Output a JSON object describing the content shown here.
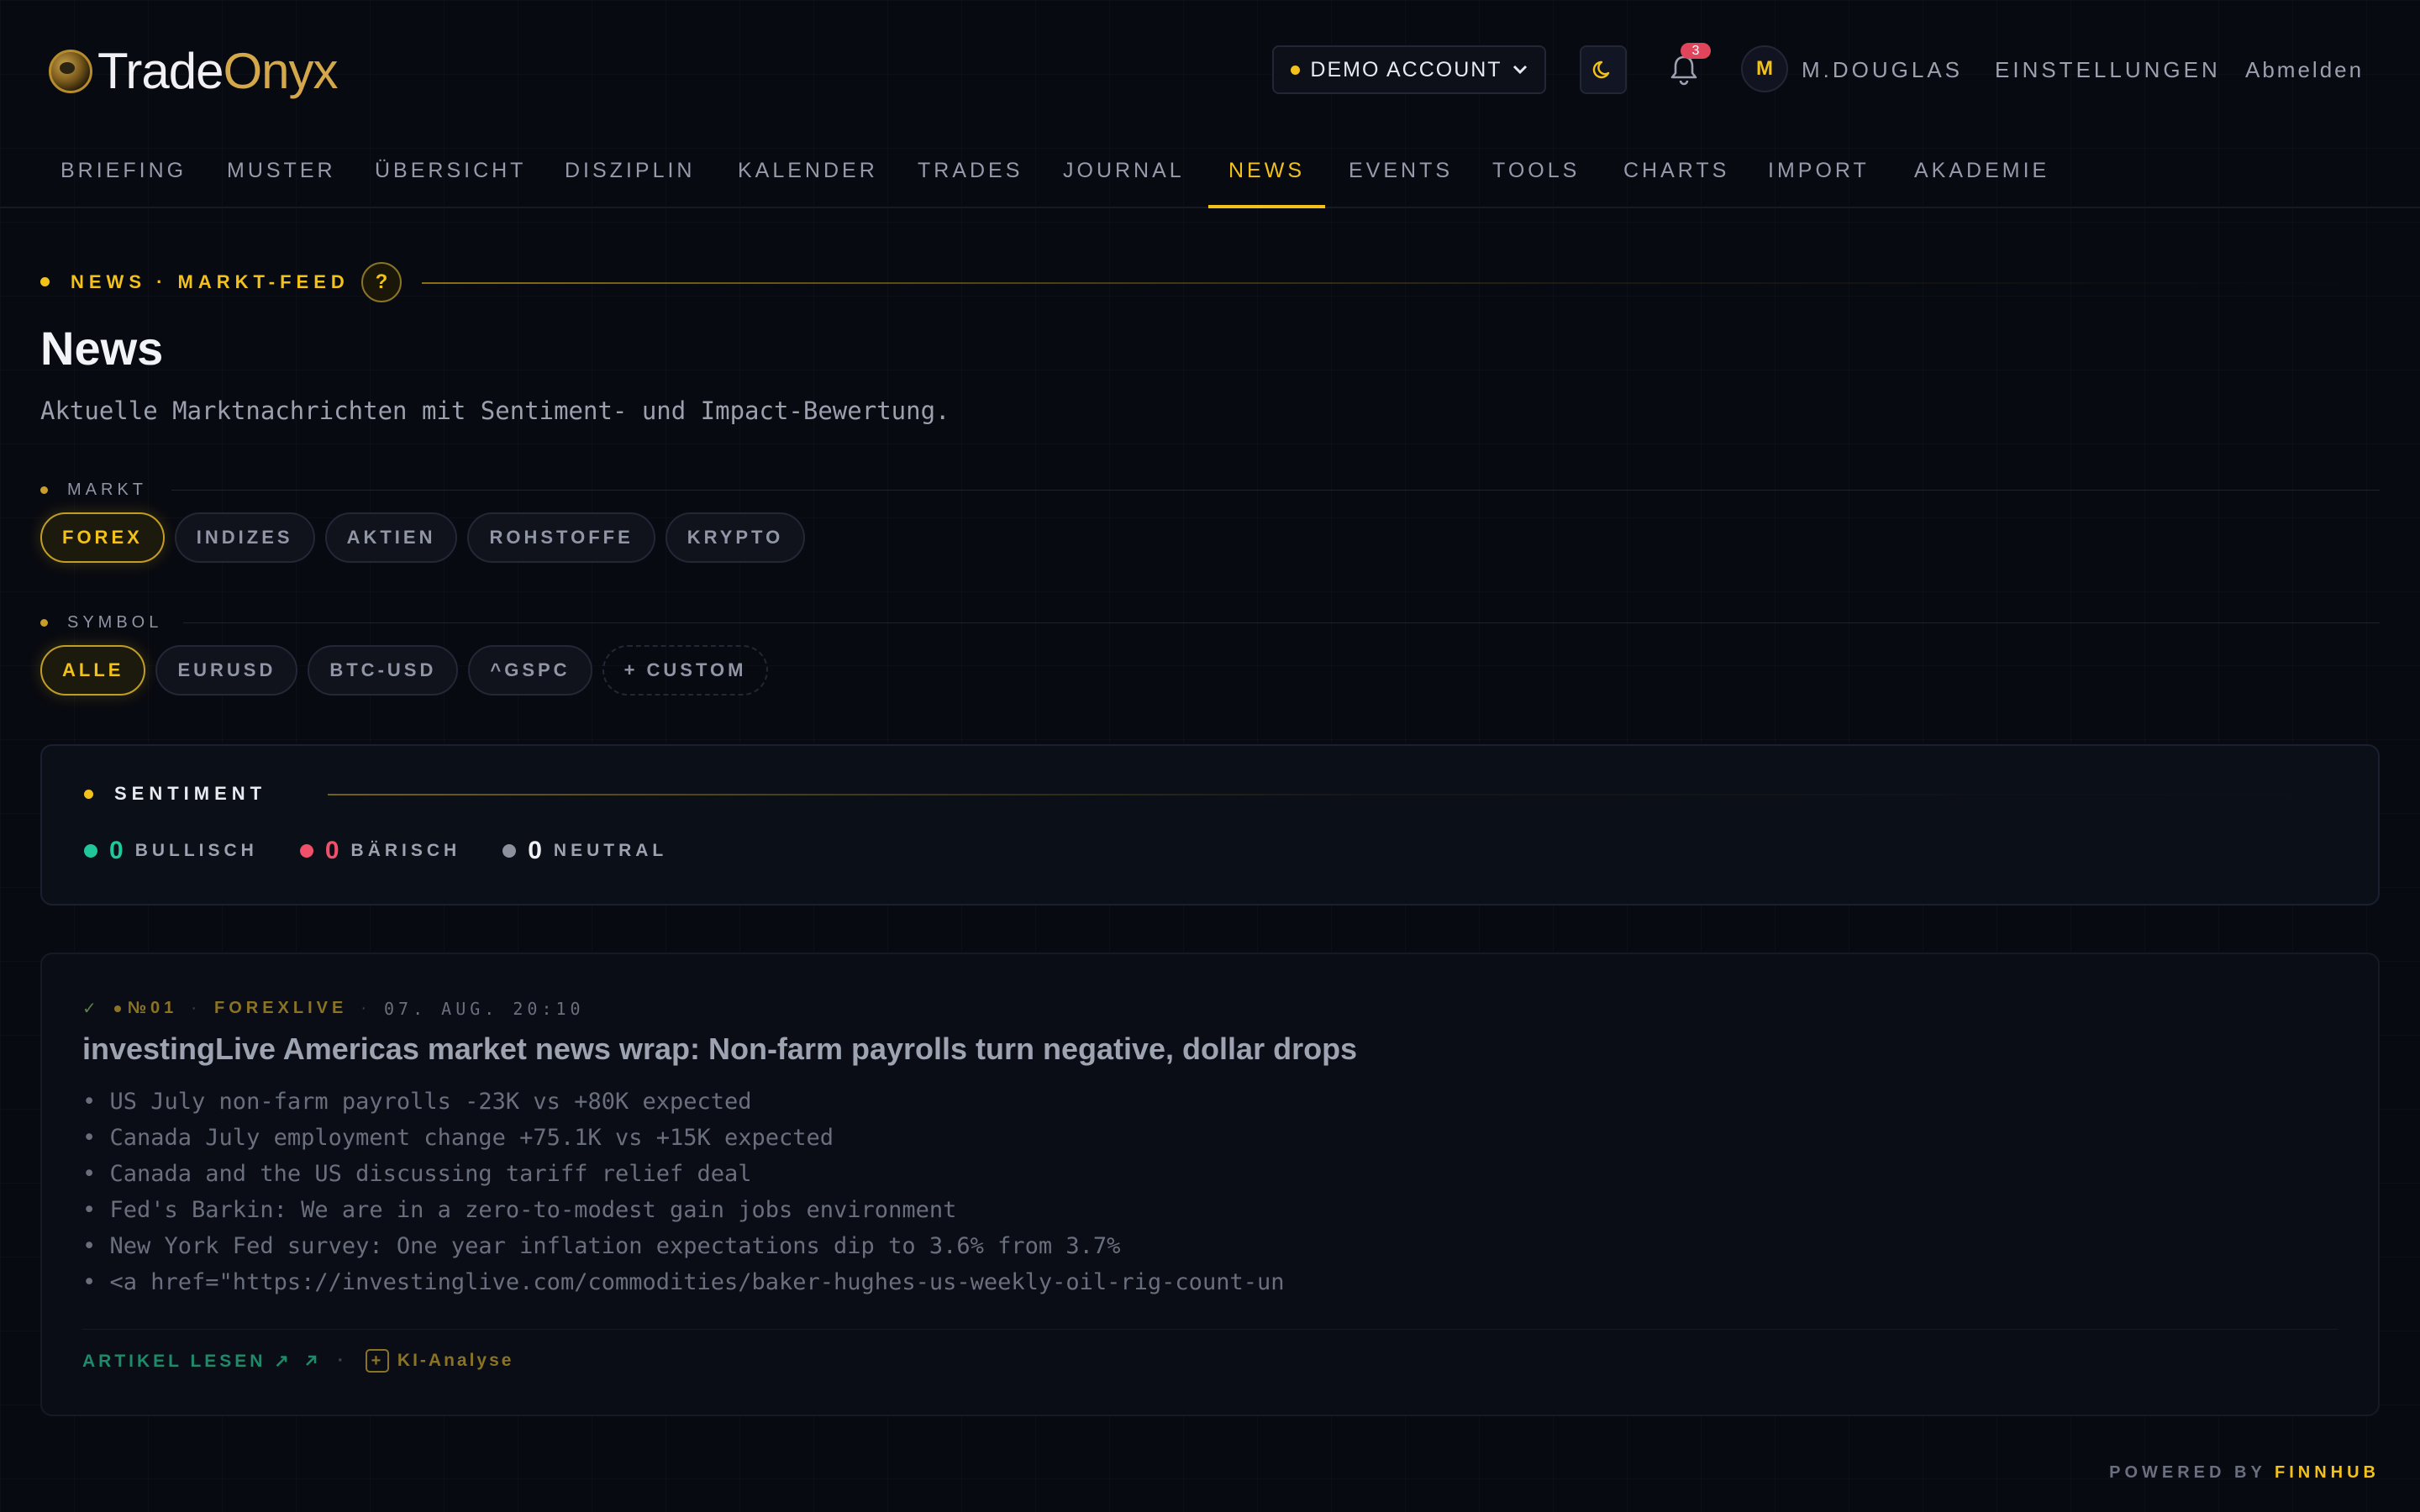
{
  "brand": {
    "name_part1": "Trade",
    "name_part2": "Onyx"
  },
  "header": {
    "account_label": "DEMO ACCOUNT",
    "notification_count": "3",
    "avatar_initial": "M",
    "user_name": "M.DOUGLAS",
    "settings_label": "EINSTELLUNGEN",
    "logout_label": "Abmelden"
  },
  "nav": {
    "items": [
      "BRIEFING",
      "MUSTER",
      "ÜBERSICHT",
      "DISZIPLIN",
      "KALENDER",
      "TRADES",
      "JOURNAL",
      "NEWS",
      "EVENTS",
      "TOOLS",
      "CHARTS",
      "IMPORT",
      "AKADEMIE"
    ],
    "active": "NEWS"
  },
  "page": {
    "eyebrow": "NEWS · MARKT-FEED",
    "help_label": "?",
    "title": "News",
    "subtitle": "Aktuelle Marktnachrichten mit Sentiment- und Impact-Bewertung."
  },
  "filters": {
    "market": {
      "label": "MARKT",
      "options": [
        "FOREX",
        "INDIZES",
        "AKTIEN",
        "ROHSTOFFE",
        "KRYPTO"
      ],
      "active": "FOREX"
    },
    "symbol": {
      "label": "SYMBOL",
      "options": [
        "ALLE",
        "EURUSD",
        "BTC-USD",
        "^GSPC"
      ],
      "active": "ALLE",
      "custom_label": "+ CUSTOM"
    }
  },
  "sentiment": {
    "title": "SENTIMENT",
    "bullish": {
      "count": "0",
      "label": "BULLISCH",
      "color": "#1fc79a"
    },
    "bearish": {
      "count": "0",
      "label": "BÄRISCH",
      "color": "#f0506a"
    },
    "neutral": {
      "count": "0",
      "label": "NEUTRAL",
      "color": "#8c91a0"
    }
  },
  "news": [
    {
      "check": "✓",
      "number": "№01",
      "source": "FOREXLIVE",
      "date": "07. AUG. 20:10",
      "title": "investingLive Americas market news wrap: Non-farm payrolls turn negative, dollar drops",
      "bullets": [
        "• US July non-farm payrolls -23K vs +80K expected",
        "• Canada July employment change +75.1K vs +15K expected",
        "• Canada and the US discussing tariff relief deal",
        "• Fed's Barkin: We are in a zero-to-modest gain jobs environment",
        "• New York Fed survey: One year inflation expectations dip to 3.6% from 3.7%",
        "• <a href=\"https://investinglive.com/commodities/baker-hughes-us-weekly-oil-rig-count-un"
      ],
      "read_label": "ARTIKEL LESEN ↗",
      "ai_label": "KI-Analyse"
    }
  ],
  "footer": {
    "powered_by": "POWERED BY",
    "provider": "FINNHUB"
  },
  "colors": {
    "accent": "#f2c21b",
    "background": "#080a11"
  }
}
